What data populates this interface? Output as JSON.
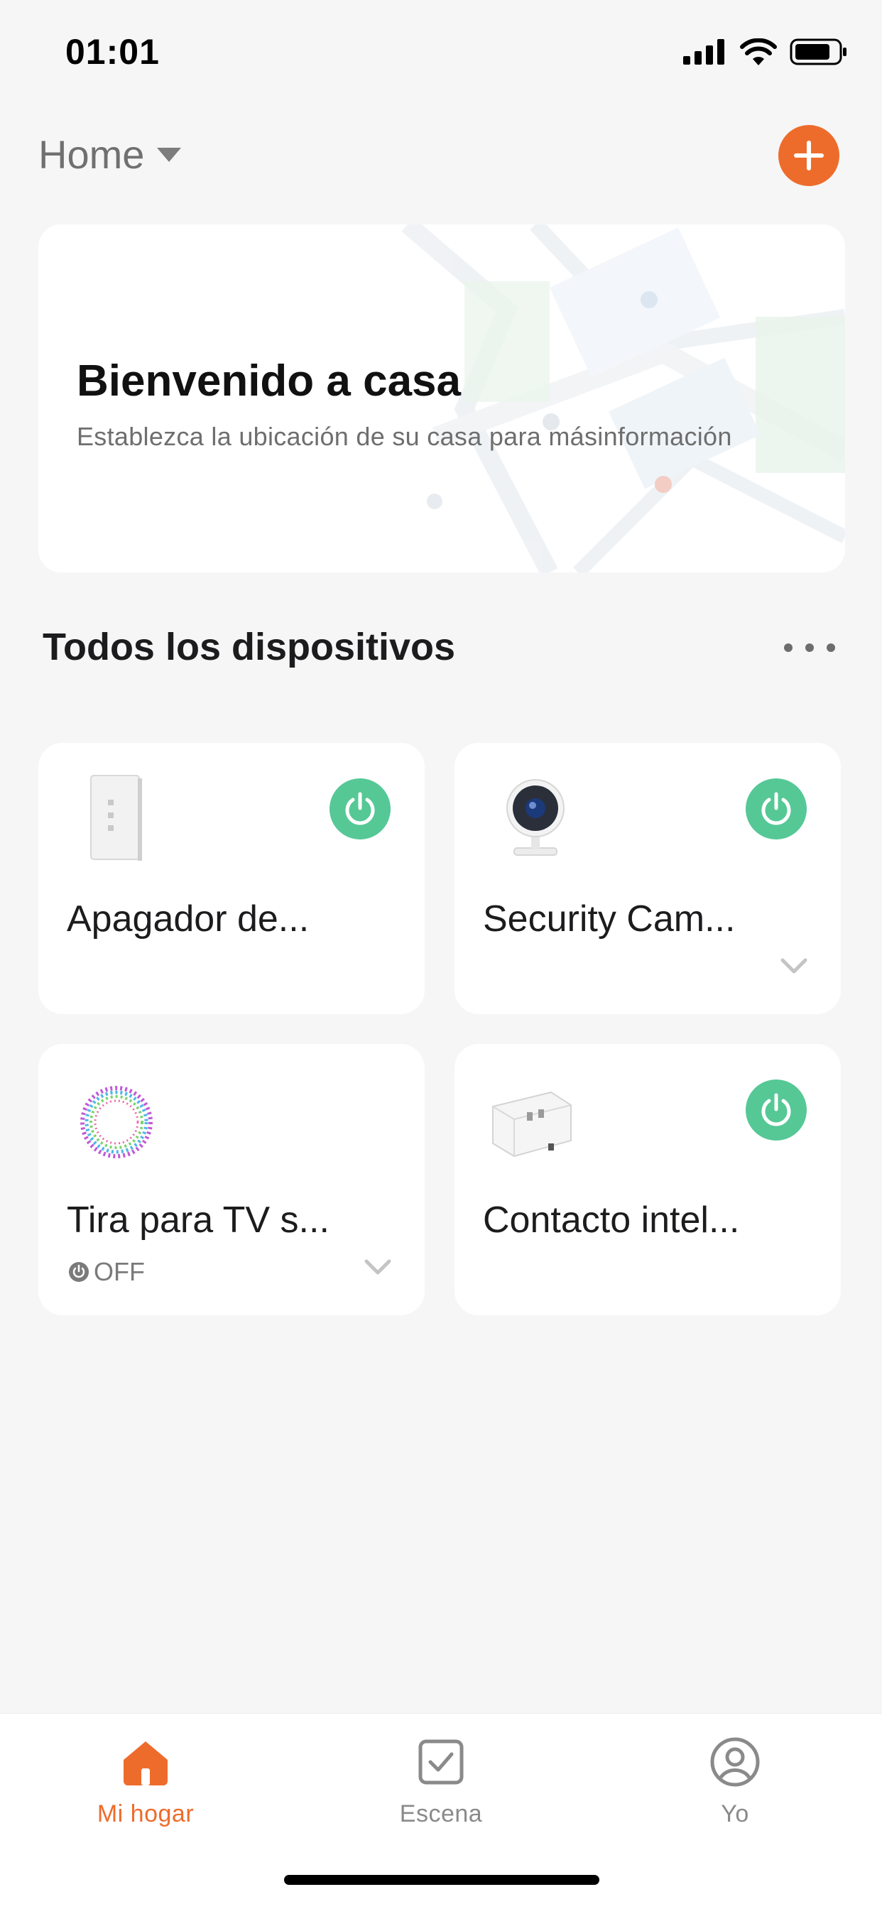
{
  "status_bar": {
    "time": "01:01"
  },
  "header": {
    "home_label": "Home",
    "home_dropdown_icon": "caret-down-icon",
    "add_icon": "plus-icon"
  },
  "welcome": {
    "title": "Bienvenido a casa",
    "subtitle": "Establezca la ubicación de su casa para másinformación"
  },
  "devices_section": {
    "title": "Todos los dispositivos",
    "more_icon": "more-dots-icon"
  },
  "devices": [
    {
      "name": "Apagador de...",
      "icon": "wall-switch-icon",
      "has_power": true,
      "status": "",
      "expandable": false
    },
    {
      "name": "Security Cam...",
      "icon": "security-camera-icon",
      "has_power": true,
      "status": "",
      "expandable": true
    },
    {
      "name": "Tira para TV s...",
      "icon": "led-strip-icon",
      "has_power": false,
      "status": "OFF",
      "expandable": true
    },
    {
      "name": "Contacto intel...",
      "icon": "smart-plug-icon",
      "has_power": true,
      "status": "",
      "expandable": false
    }
  ],
  "tab_bar": {
    "tabs": [
      {
        "label": "Mi hogar",
        "icon": "home-icon",
        "active": true
      },
      {
        "label": "Escena",
        "icon": "scene-checkbox-icon",
        "active": false
      },
      {
        "label": "Yo",
        "icon": "profile-icon",
        "active": false
      }
    ]
  },
  "colors": {
    "accent": "#ee6c2b",
    "power_on": "#55c896",
    "background": "#f6f6f6"
  }
}
